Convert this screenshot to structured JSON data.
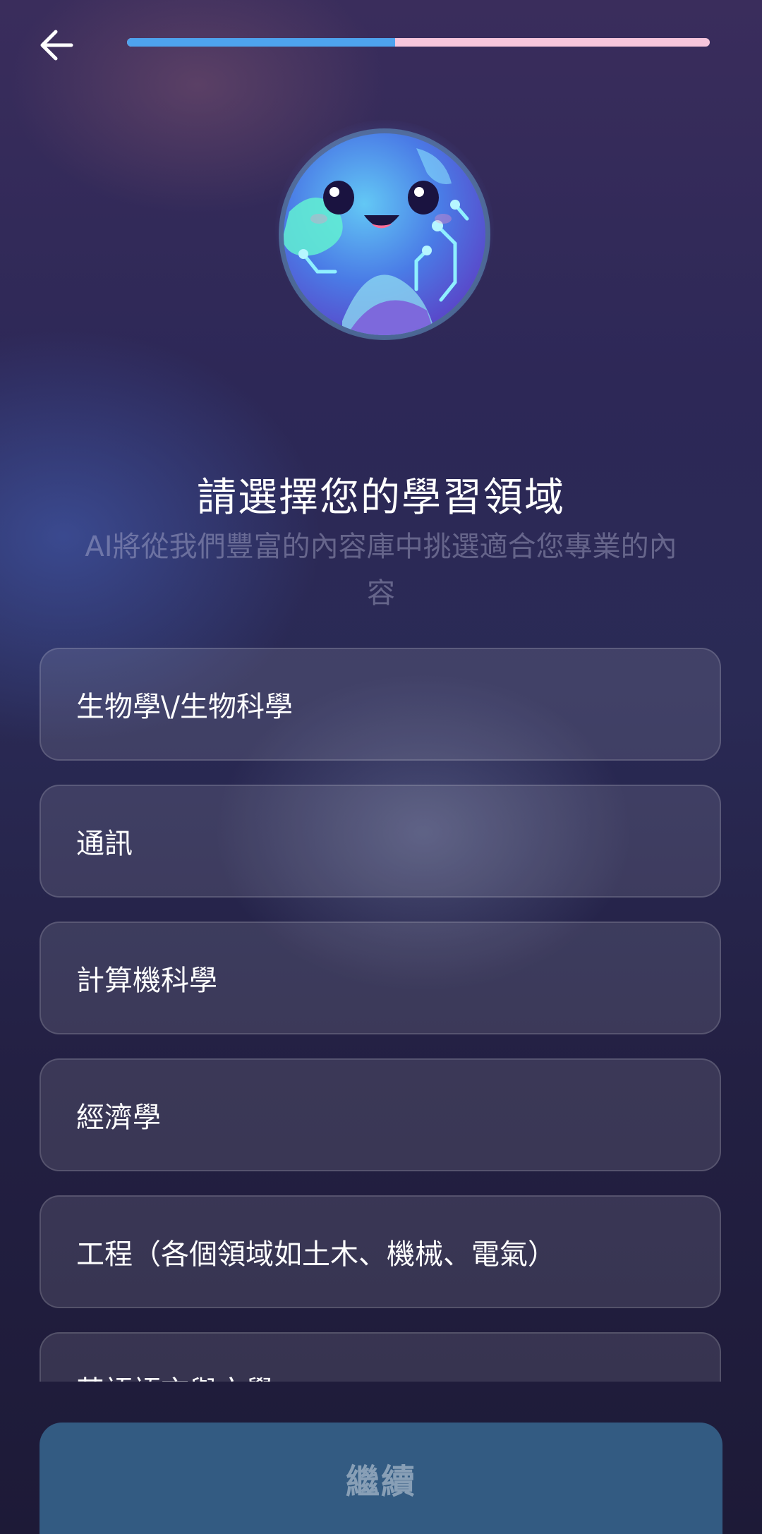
{
  "header": {
    "back_icon": "arrow-left-icon",
    "progress": 0.46,
    "progress_color": "#4ea3ee",
    "track_color": "#f7c6dc"
  },
  "mascot": {
    "icon": "smiling-globe-mascot"
  },
  "title": "請選擇您的學習領域",
  "subtitle": "AI將從我們豐富的內容庫中挑選適合您專業的內容",
  "options": [
    "生物學\\/生物科學",
    "通訊",
    "計算機科學",
    "經濟學",
    "工程（各個領域如土木、機械、電氣）",
    "英語語言與文學"
  ],
  "continue_label": "繼續",
  "colors": {
    "button": "#335b82"
  }
}
